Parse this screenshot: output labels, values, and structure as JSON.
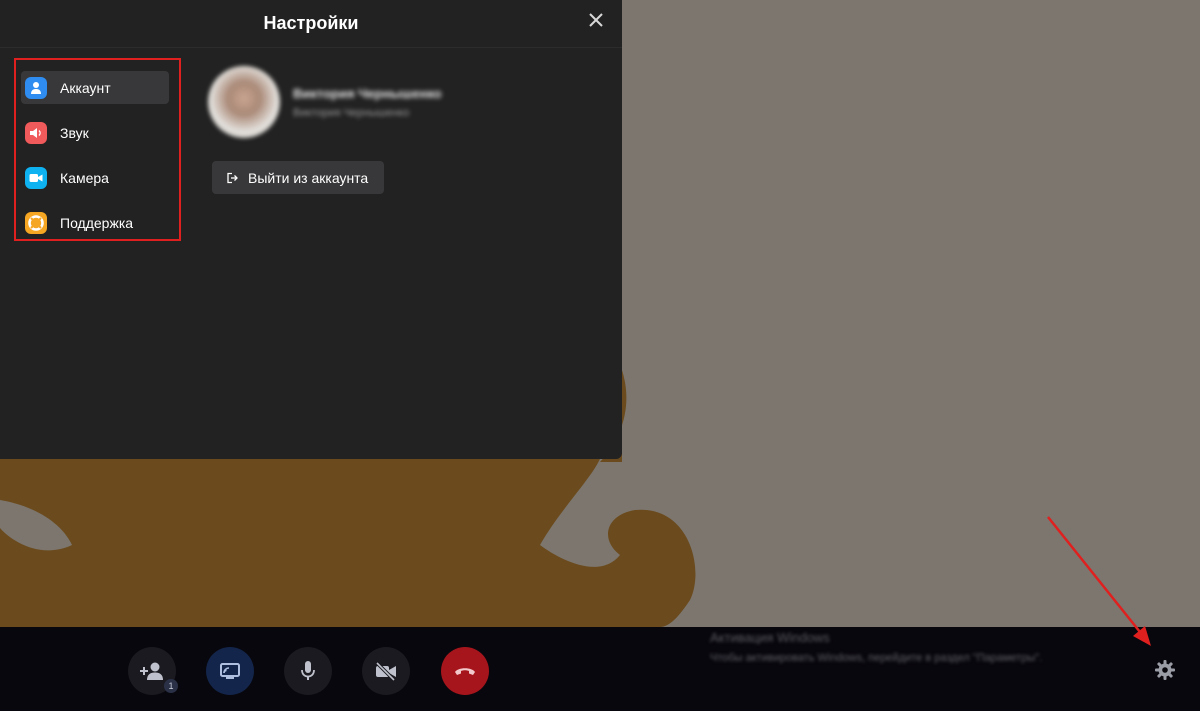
{
  "settings": {
    "title": "Настройки",
    "nav_items": [
      {
        "label": "Аккаунт",
        "icon": "user-icon",
        "color": "#2f8cf0",
        "active": true
      },
      {
        "label": "Звук",
        "icon": "speaker-icon",
        "color": "#f05a5a",
        "active": false
      },
      {
        "label": "Камера",
        "icon": "camera-icon",
        "color": "#0fb2f0",
        "active": false
      },
      {
        "label": "Поддержка",
        "icon": "lifebuoy-icon",
        "color": "#f5a623",
        "active": false
      }
    ],
    "profile": {
      "name": "Виктория Чернышенко",
      "subtitle": "Виктория Чернышенко"
    },
    "logout_label": "Выйти из аккаунта"
  },
  "toolbar": {
    "invite_badge": "1",
    "buttons": [
      {
        "icon": "add-user-icon"
      },
      {
        "icon": "screen-share-icon"
      },
      {
        "icon": "microphone-icon"
      },
      {
        "icon": "camera-off-icon"
      },
      {
        "icon": "hang-up-icon"
      },
      {
        "icon": "gear-icon"
      }
    ]
  },
  "watermark": {
    "line1": "Активация Windows",
    "line2": "Чтобы активировать Windows, перейдите в раздел \"Параметры\"."
  },
  "colors": {
    "panel_bg": "#222222",
    "highlight": "#e0201e",
    "hangup": "#c0272d",
    "share": "#13254a"
  }
}
